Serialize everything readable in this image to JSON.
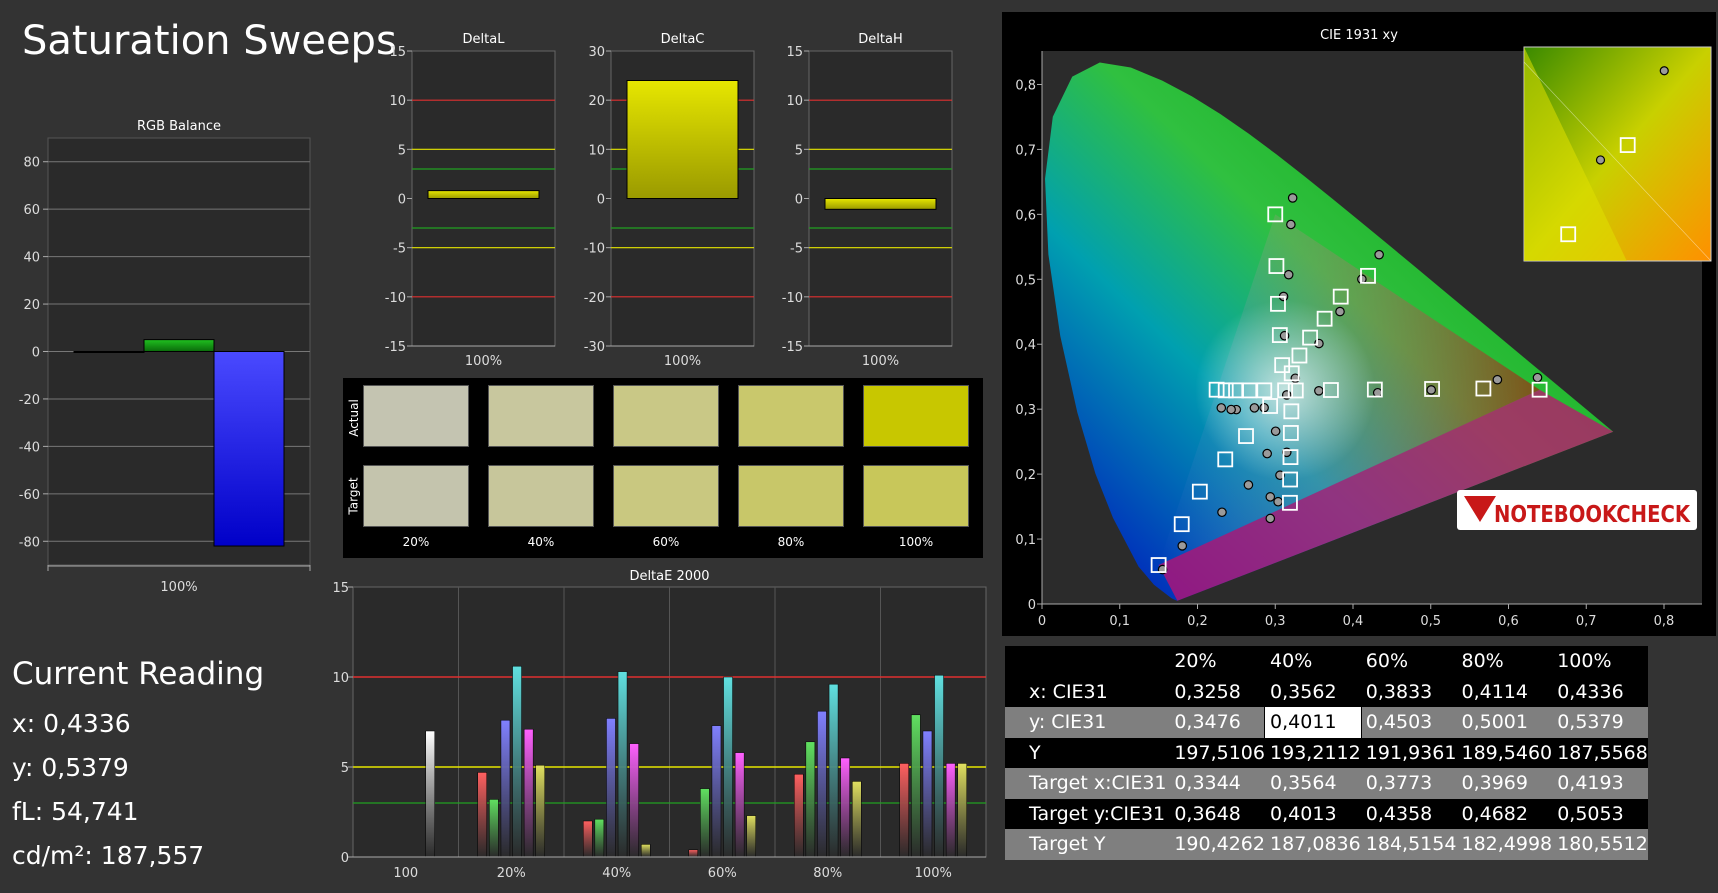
{
  "title": "Saturation Sweeps",
  "current_reading": {
    "title": "Current Reading",
    "x": "x: 0,4336",
    "y": "y: 0,5379",
    "fl": "fL: 54,741",
    "cdm2": "cd/m²: 187,557"
  },
  "swatches": {
    "actual_label": "Actual",
    "target_label": "Target",
    "labels": [
      "20%",
      "40%",
      "60%",
      "80%",
      "100%"
    ],
    "actual_colors": [
      "#c4c4b1",
      "#c8c79e",
      "#c9c886",
      "#c9c86c",
      "#c8c700"
    ],
    "target_colors": [
      "#c4c4ad",
      "#c7c69b",
      "#c9c880",
      "#c8c769",
      "#c8c75a"
    ]
  },
  "table": {
    "headers": [
      "",
      "20%",
      "40%",
      "60%",
      "80%",
      "100%"
    ],
    "rows": [
      {
        "label": "x: CIE31",
        "values": [
          "0,3258",
          "0,3562",
          "0,3833",
          "0,4114",
          "0,4336"
        ]
      },
      {
        "label": "y: CIE31",
        "values": [
          "0,3476",
          "0,4011",
          "0,4503",
          "0,5001",
          "0,5379"
        ]
      },
      {
        "label": "Y",
        "values": [
          "197,5106",
          "193,2112",
          "191,9361",
          "189,5460",
          "187,5568"
        ]
      },
      {
        "label": "Target x:CIE31",
        "values": [
          "0,3344",
          "0,3564",
          "0,3773",
          "0,3969",
          "0,4193"
        ]
      },
      {
        "label": "Target y:CIE31",
        "values": [
          "0,3648",
          "0,4013",
          "0,4358",
          "0,4682",
          "0,5053"
        ]
      },
      {
        "label": "Target Y",
        "values": [
          "190,4262",
          "187,0836",
          "184,5154",
          "182,4998",
          "180,5512"
        ]
      }
    ]
  },
  "logo_text": "NOTEBOOKCHECK",
  "chart_data": [
    {
      "type": "bar",
      "title": "RGB Balance",
      "categories": [
        "100%"
      ],
      "series": [
        {
          "name": "R",
          "values": [
            0
          ],
          "color": "#ff0000"
        },
        {
          "name": "G",
          "values": [
            5
          ],
          "color": "#00a000"
        },
        {
          "name": "B",
          "values": [
            -82
          ],
          "color": "#1a1aff"
        }
      ],
      "yticks": [
        "80",
        "60",
        "40",
        "20",
        "0",
        "-20",
        "-40",
        "-60",
        "-80"
      ],
      "ylim": [
        -90,
        90
      ]
    },
    {
      "type": "bar",
      "title": "DeltaL",
      "categories": [
        "100%"
      ],
      "values": [
        0.8
      ],
      "yticks": [
        "15",
        "10",
        "5",
        "0",
        "-5",
        "-10",
        "-15"
      ],
      "ylim": [
        -15,
        15
      ]
    },
    {
      "type": "bar",
      "title": "DeltaC",
      "categories": [
        "100%"
      ],
      "values": [
        24
      ],
      "yticks": [
        "30",
        "20",
        "10",
        "0",
        "-10",
        "-20",
        "-30"
      ],
      "ylim": [
        -30,
        30
      ]
    },
    {
      "type": "bar",
      "title": "DeltaH",
      "categories": [
        "100%"
      ],
      "values": [
        -1.1
      ],
      "yticks": [
        "15",
        "10",
        "5",
        "0",
        "-5",
        "-10",
        "-15"
      ],
      "ylim": [
        -15,
        15
      ]
    },
    {
      "type": "bar",
      "title": "DeltaE 2000",
      "categories": [
        "100",
        "20%",
        "40%",
        "60%",
        "80%",
        "100%"
      ],
      "bar_colors": [
        "#ff6060",
        "#60e060",
        "#8080ff",
        "#60e0e0",
        "#ff60ff",
        "#e0e060",
        "#ffffff"
      ],
      "groups": [
        [
          0,
          0,
          0,
          0,
          0,
          0,
          7.0
        ],
        [
          4.7,
          3.2,
          7.6,
          10.6,
          7.1,
          5.1,
          0
        ],
        [
          2.0,
          2.1,
          7.7,
          10.3,
          6.3,
          0.7,
          0
        ],
        [
          0.4,
          3.8,
          7.3,
          10.0,
          5.8,
          2.3,
          0
        ],
        [
          4.6,
          6.4,
          8.1,
          9.6,
          5.5,
          4.2,
          0
        ],
        [
          5.2,
          7.9,
          7.0,
          10.1,
          5.2,
          5.2,
          0
        ]
      ],
      "yticks": [
        "15",
        "10",
        "5",
        "0"
      ],
      "ylim": [
        0,
        15
      ]
    },
    {
      "type": "scatter",
      "title": "CIE 1931 xy",
      "xticks": [
        "0",
        "0,1",
        "0,2",
        "0,3",
        "0,4",
        "0,5",
        "0,6",
        "0,7",
        "0,8"
      ],
      "yticks": [
        "0",
        "0,1",
        "0,2",
        "0,3",
        "0,4",
        "0,5",
        "0,6",
        "0,7",
        "0,8"
      ],
      "xlim": [
        0,
        0.8
      ],
      "ylim": [
        0,
        0.85
      ],
      "gamut": [
        [
          0.64,
          0.33
        ],
        [
          0.3,
          0.6
        ],
        [
          0.15,
          0.06
        ]
      ],
      "targets": [
        [
          0.3127,
          0.329
        ],
        [
          0.3264,
          0.3288
        ],
        [
          0.3716,
          0.3295
        ],
        [
          0.4281,
          0.3302
        ],
        [
          0.5017,
          0.3311
        ],
        [
          0.5677,
          0.3318
        ],
        [
          0.64,
          0.33
        ],
        [
          0.3089,
          0.3678
        ],
        [
          0.3059,
          0.4141
        ],
        [
          0.3035,
          0.4622
        ],
        [
          0.3015,
          0.5204
        ],
        [
          0.3,
          0.6
        ],
        [
          0.2934,
          0.3049
        ],
        [
          0.2624,
          0.2586
        ],
        [
          0.2357,
          0.2227
        ],
        [
          0.203,
          0.173
        ],
        [
          0.1797,
          0.1229
        ],
        [
          0.15,
          0.06
        ],
        [
          0.3212,
          0.3552
        ],
        [
          0.3311,
          0.3826
        ],
        [
          0.3448,
          0.4102
        ],
        [
          0.3635,
          0.4393
        ],
        [
          0.3842,
          0.4733
        ],
        [
          0.4193,
          0.5053
        ],
        [
          0.2859,
          0.329
        ],
        [
          0.2666,
          0.3289
        ],
        [
          0.2496,
          0.329
        ],
        [
          0.2363,
          0.329
        ],
        [
          0.2246,
          0.33
        ],
        [
          0.3207,
          0.2967
        ],
        [
          0.3201,
          0.2634
        ],
        [
          0.3196,
          0.2262
        ],
        [
          0.3191,
          0.1917
        ],
        [
          0.3189,
          0.1558
        ]
      ],
      "measured": [
        [
          0.3148,
          0.3219
        ],
        [
          0.3561,
          0.3283
        ],
        [
          0.4318,
          0.3253
        ],
        [
          0.5006,
          0.3296
        ],
        [
          0.5857,
          0.3454
        ],
        [
          0.6373,
          0.3486
        ],
        [
          0.312,
          0.4131
        ],
        [
          0.3107,
          0.4736
        ],
        [
          0.3173,
          0.5071
        ],
        [
          0.3201,
          0.5844
        ],
        [
          0.3224,
          0.6253
        ],
        [
          0.2857,
          0.3022
        ],
        [
          0.2732,
          0.302
        ],
        [
          0.2499,
          0.2993
        ],
        [
          0.2433,
          0.2995
        ],
        [
          0.2306,
          0.302
        ],
        [
          0.3258,
          0.3476
        ],
        [
          0.3562,
          0.4011
        ],
        [
          0.3833,
          0.4503
        ],
        [
          0.4114,
          0.5001
        ],
        [
          0.4336,
          0.5379
        ],
        [
          0.3005,
          0.266
        ],
        [
          0.2896,
          0.2316
        ],
        [
          0.2655,
          0.1834
        ],
        [
          0.2315,
          0.1413
        ],
        [
          0.1804,
          0.0896
        ],
        [
          0.1551,
          0.053
        ],
        [
          0.3148,
          0.2336
        ],
        [
          0.3061,
          0.1983
        ],
        [
          0.3037,
          0.1575
        ],
        [
          0.2936,
          0.1317
        ],
        [
          0.2936,
          0.165
        ]
      ],
      "inset_measured": [
        [
          0.69,
          0.67
        ],
        [
          0.765,
          0.82
        ]
      ],
      "inset_targets": [
        [
          0.722,
          0.695
        ],
        [
          0.652,
          0.545
        ]
      ]
    }
  ]
}
